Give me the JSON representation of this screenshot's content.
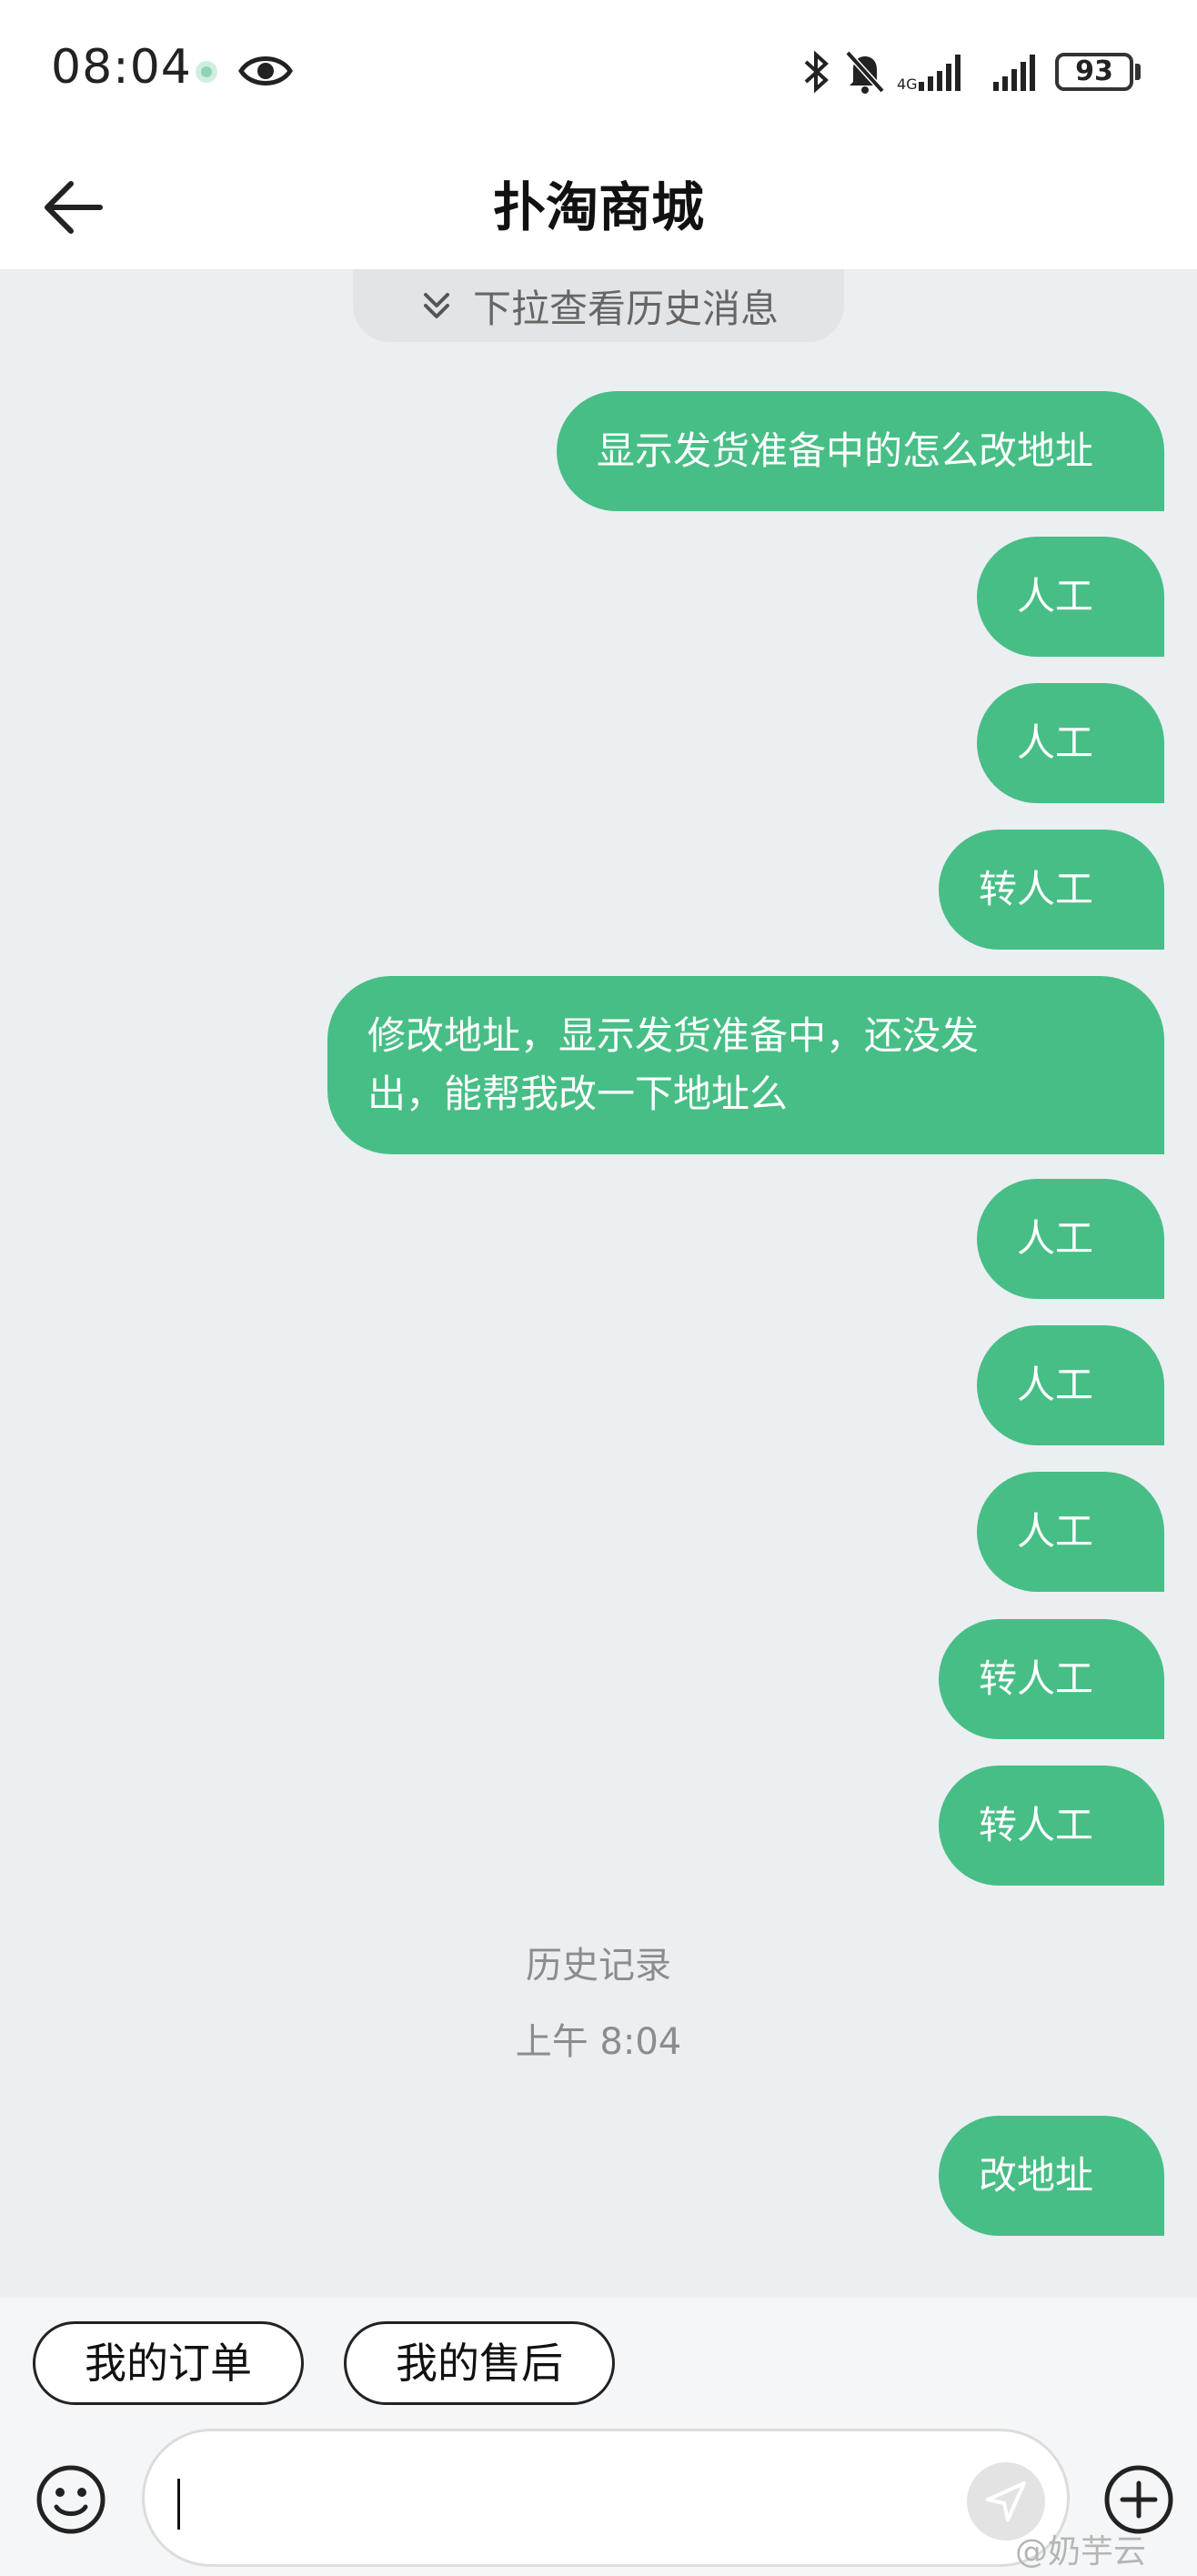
{
  "status_bar": {
    "time": "08:04",
    "battery": "93",
    "icons": [
      "app-notification-icon",
      "eye-icon",
      "bluetooth-icon",
      "muted-bell-icon",
      "signal-icon",
      "signal-icon-2",
      "battery-icon"
    ]
  },
  "header": {
    "title": "扑淘商城",
    "back_icon": "arrow-left-icon"
  },
  "history_pill": {
    "label": "下拉查看历史消息",
    "icon": "double-chevron-down-icon"
  },
  "messages": [
    {
      "text": "显示发货准备中的怎么改地址"
    },
    {
      "text": "人工"
    },
    {
      "text": "人工"
    },
    {
      "text": "转人工"
    },
    {
      "text": "修改地址，显示发货准备中，还没发\n出，能帮我改一下地址么"
    },
    {
      "text": "人工"
    },
    {
      "text": "人工"
    },
    {
      "text": "人工"
    },
    {
      "text": "转人工"
    },
    {
      "text": "转人工"
    },
    {
      "text": "改地址"
    }
  ],
  "system": {
    "history_label": "历史记录",
    "timestamp": "上午 8:04"
  },
  "quick_actions": [
    {
      "label": "我的订单"
    },
    {
      "label": "我的售后"
    }
  ],
  "input": {
    "value": "",
    "emoji_icon": "smiley-icon",
    "send_icon": "send-arrow-icon",
    "plus_icon": "plus-circle-icon"
  },
  "watermark": "@奶芋云",
  "colors": {
    "bubble": "#47be86",
    "background": "#ebeff2",
    "header": "#ffffff"
  }
}
